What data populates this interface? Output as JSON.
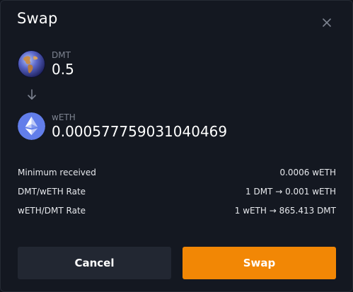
{
  "dialog": {
    "title": "Swap"
  },
  "from_token": {
    "symbol": "DMT",
    "amount": "0.5",
    "icon": "globe-icon"
  },
  "to_token": {
    "symbol": "wETH",
    "amount": "0.000577759031040469",
    "icon": "ethereum-icon"
  },
  "details": [
    {
      "label": "Minimum received",
      "value": "0.0006 wETH"
    },
    {
      "label": "DMT/wETH Rate",
      "value": "1 DMT → 0.001 wETH"
    },
    {
      "label": "wETH/DMT Rate",
      "value": "1 wETH → 865.413 DMT"
    }
  ],
  "buttons": {
    "cancel_label": "Cancel",
    "swap_label": "Swap"
  },
  "colors": {
    "background": "#141821",
    "accent": "#f28705",
    "secondary_button": "#222732",
    "muted_text": "#7d8390",
    "ethereum_blue": "#627eea"
  }
}
